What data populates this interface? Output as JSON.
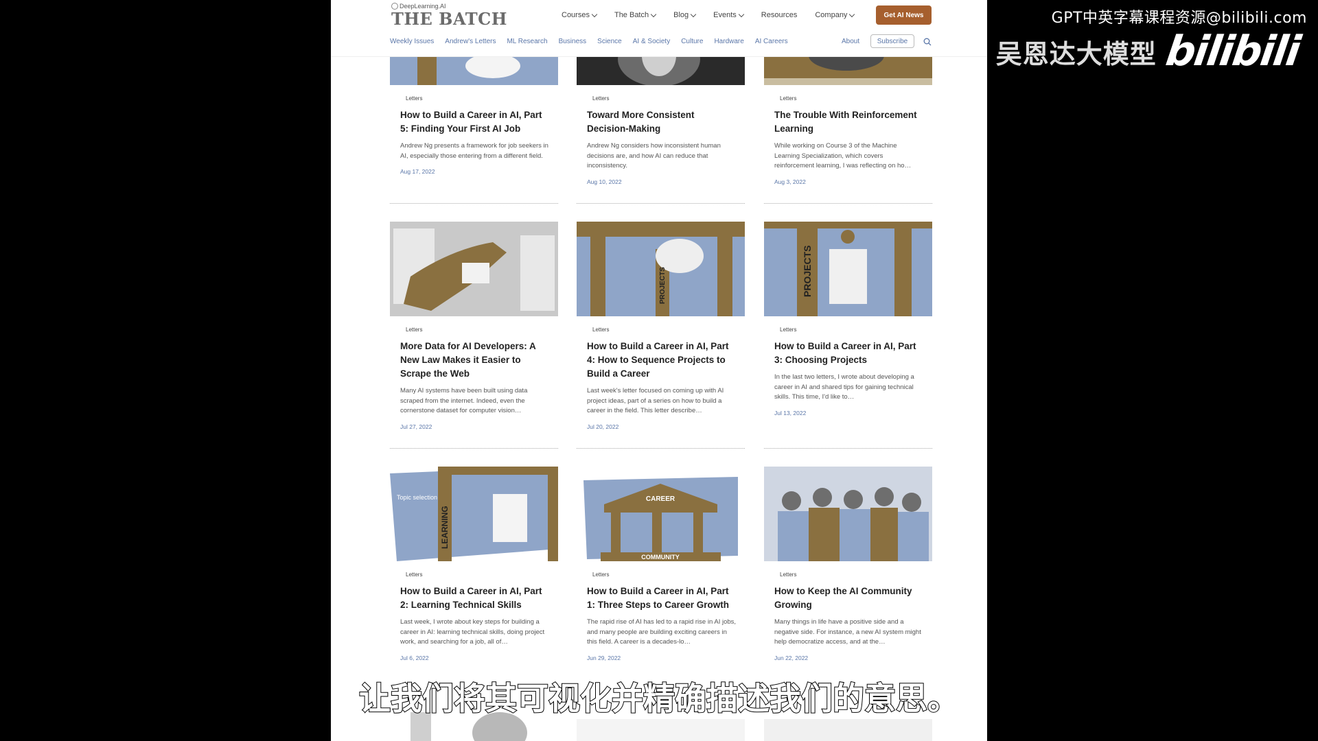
{
  "watermark": {
    "top_text": "GPT中英字幕课程资源@bilibili.com",
    "cn_text": "吴恩达大模型",
    "logo": "bilibili"
  },
  "brand": {
    "sub": "DeepLearning.AI",
    "title": "THE BATCH"
  },
  "topnav": [
    {
      "label": "Courses",
      "dropdown": true
    },
    {
      "label": "The Batch",
      "dropdown": true
    },
    {
      "label": "Blog",
      "dropdown": true
    },
    {
      "label": "Events",
      "dropdown": true
    },
    {
      "label": "Resources",
      "dropdown": false
    },
    {
      "label": "Company",
      "dropdown": true
    }
  ],
  "cta_label": "Get AI News",
  "subnav": [
    "Weekly Issues",
    "Andrew's Letters",
    "ML Research",
    "Business",
    "Science",
    "AI & Society",
    "Culture",
    "Hardware",
    "AI Careers"
  ],
  "about_label": "About",
  "subscribe_label": "Subscribe",
  "icons": {
    "search": "search-icon",
    "chevron": "chevron-down-icon"
  },
  "colors": {
    "accent": "#a65f2e",
    "link": "#5a76a8",
    "illustration_gold": "#8a7040",
    "illustration_blue": "#8fa5c8"
  },
  "cards": [
    {
      "category": "Letters",
      "title": "How to Build a Career in AI, Part 5: Finding Your First AI Job",
      "desc": "Andrew Ng presents a framework for job seekers in AI, especially those entering from a different field.",
      "date": "Aug 17, 2022"
    },
    {
      "category": "Letters",
      "title": "Toward More Consistent Decision-Making",
      "desc": "Andrew Ng considers how inconsistent human decisions are, and how AI can reduce that inconsistency.",
      "date": "Aug 10, 2022"
    },
    {
      "category": "Letters",
      "title": "The Trouble With Reinforcement Learning",
      "desc": "While working on Course 3 of the Machine Learning Specialization, which covers reinforcement learning, I was reflecting on ho…",
      "date": "Aug 3, 2022"
    },
    {
      "category": "Letters",
      "title": "More Data for AI Developers: A New Law Makes it Easier to Scrape the Web",
      "desc": "Many AI systems have been built using data scraped from the internet. Indeed, even the cornerstone dataset for computer vision…",
      "date": "Jul 27, 2022"
    },
    {
      "category": "Letters",
      "title": "How to Build a Career in AI, Part 4: How to Sequence Projects to Build a Career",
      "desc": "Last week's letter focused on coming up with AI project ideas, part of a series on how to build a career in the field. This letter describe…",
      "date": "Jul 20, 2022"
    },
    {
      "category": "Letters",
      "title": "How to Build a Career in AI, Part 3: Choosing Projects",
      "desc": "In the last two letters, I wrote about developing a career in AI and shared tips for gaining technical skills. This time, I'd like to…",
      "date": "Jul 13, 2022"
    },
    {
      "category": "Letters",
      "title": "How to Build a Career in AI, Part 2: Learning Technical Skills",
      "desc": "Last week, I wrote about key steps for building a career in AI: learning technical skills, doing project work, and searching for a job, all of…",
      "date": "Jul 6, 2022"
    },
    {
      "category": "Letters",
      "title": "How to Build a Career in AI, Part 1: Three Steps to Career Growth",
      "desc": "The rapid rise of AI has led to a rapid rise in AI jobs, and many people are building exciting careers in this field. A career is a decades-lo…",
      "date": "Jun 29, 2022"
    },
    {
      "category": "Letters",
      "title": "How to Keep the AI Community Growing",
      "desc": "Many things in life have a positive side and a negative side. For instance, a new AI system might help democratize access, and at the…",
      "date": "Jun 22, 2022"
    }
  ],
  "illustration_text": {
    "projects": "PROJECTS",
    "learning": "LEARNING",
    "topic": "Topic selection",
    "career": "CAREER",
    "community": "COMMUNITY"
  },
  "subtitle": "让我们将其可视化并精确描述我们的意思。"
}
